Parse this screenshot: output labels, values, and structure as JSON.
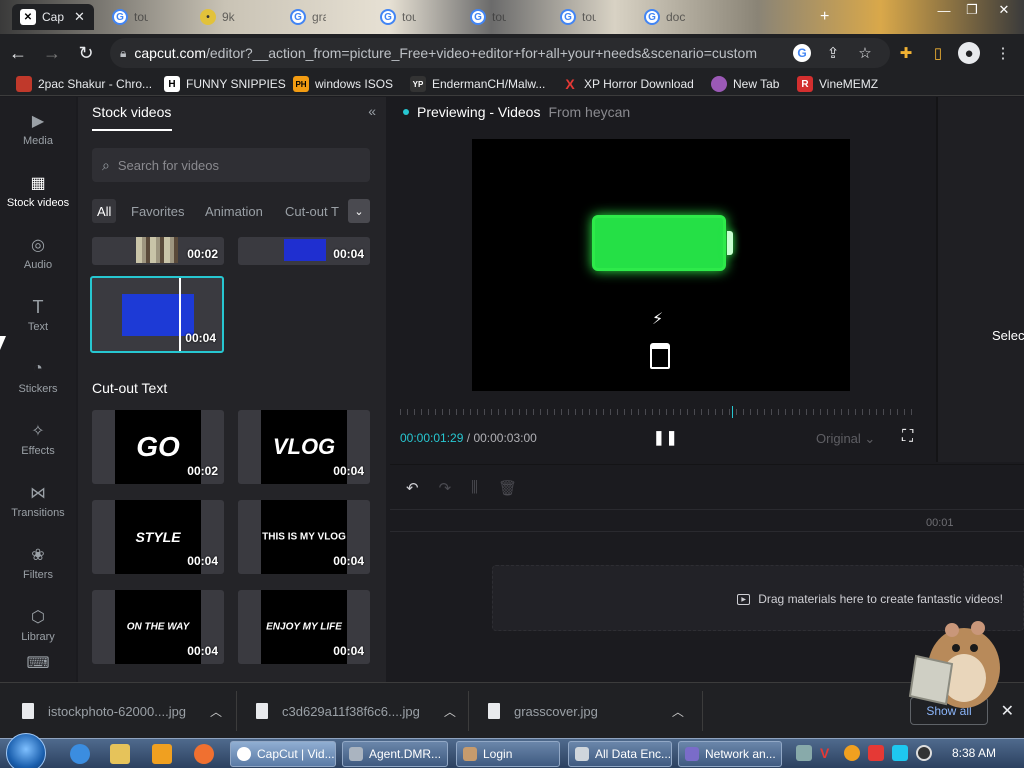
{
  "browser": {
    "tabs": [
      {
        "title": "Cap",
        "icon": "capcut-icon",
        "active": true
      },
      {
        "title": "tou",
        "icon": "google-icon"
      },
      {
        "title": "9k",
        "icon": "image-icon"
      },
      {
        "title": "gra",
        "icon": "google-icon"
      },
      {
        "title": "tou",
        "icon": "google-icon"
      },
      {
        "title": "tou",
        "icon": "google-icon"
      },
      {
        "title": "tou",
        "icon": "google-icon"
      },
      {
        "title": "doc",
        "icon": "google-icon"
      }
    ],
    "url_domain": "capcut.com",
    "url_rest": "/editor?__action_from=picture_Free+video+editor+for+all+your+needs&scenario=custom",
    "bookmarks": [
      {
        "label": "2pac Shakur - Chro...",
        "icon": "bookmark-2pac-icon",
        "color": "#c0392b"
      },
      {
        "label": "FUNNY SNIPPIES",
        "icon": "bookmark-h-icon",
        "glyph": "H",
        "color": "#ffffff"
      },
      {
        "label": "windows ISOS",
        "icon": "bookmark-ph-icon",
        "glyph": "PH",
        "color": "#f39c12"
      },
      {
        "label": "EndermanCH/Malw...",
        "icon": "bookmark-yp-icon",
        "glyph": "YP",
        "color": "#222222"
      },
      {
        "label": "XP Horror Download",
        "icon": "bookmark-x-icon",
        "glyph": "X",
        "color": "#e53935"
      },
      {
        "label": "New Tab",
        "icon": "bookmark-newtab-icon",
        "color": "#9b59b6"
      },
      {
        "label": "VineMEMZ",
        "icon": "bookmark-r-icon",
        "glyph": "R",
        "color": "#d32f2f"
      }
    ]
  },
  "capcut": {
    "left_nav": [
      {
        "label": "Media",
        "icon": "media-icon",
        "glyph": "▶"
      },
      {
        "label": "Stock videos",
        "icon": "stock-videos-icon",
        "glyph": "▦",
        "active": true
      },
      {
        "label": "Audio",
        "icon": "audio-icon",
        "glyph": "◎"
      },
      {
        "label": "Text",
        "icon": "text-icon",
        "glyph": "T"
      },
      {
        "label": "Stickers",
        "icon": "stickers-icon",
        "glyph": "◔"
      },
      {
        "label": "Effects",
        "icon": "effects-icon",
        "glyph": "✧"
      },
      {
        "label": "Transitions",
        "icon": "transitions-icon",
        "glyph": "⋈"
      },
      {
        "label": "Filters",
        "icon": "filters-icon",
        "glyph": "❀"
      },
      {
        "label": "Library",
        "icon": "library-icon",
        "glyph": "⬡"
      }
    ],
    "panel": {
      "title": "Stock videos",
      "search_placeholder": "Search for videos",
      "filters": [
        "All",
        "Favorites",
        "Animation",
        "Cut-out T"
      ],
      "top_clips": [
        {
          "duration": "00:02"
        },
        {
          "duration": "00:04"
        },
        {
          "duration": "00:04",
          "selected": true
        }
      ],
      "section_title": "Cut-out Text",
      "cutout_clips": [
        {
          "text": "GO",
          "duration": "00:02"
        },
        {
          "text": "VLOG",
          "duration": "00:04"
        },
        {
          "text": "STYLE",
          "duration": "00:04"
        },
        {
          "text": "THIS IS MY VLOG",
          "duration": "00:04"
        },
        {
          "text": "ON THE WAY",
          "duration": "00:04"
        },
        {
          "text": "ENJOY MY LIFE",
          "duration": "00:04"
        }
      ]
    },
    "preview": {
      "title": "Previewing - Videos",
      "source": "From heycan",
      "current_time": "00:00:01:29",
      "separator": "/",
      "total_time": "00:00:03:00",
      "ratio": "Original",
      "progress": 0.64
    },
    "right_pane": {
      "text": "Selec"
    },
    "timeline": {
      "time_mark": "00:01",
      "drop_text": "Drag materials here to create fantastic videos!"
    }
  },
  "downloads": [
    {
      "name": "istockphoto-62000....jpg"
    },
    {
      "name": "c3d629a11f38f6c6....jpg"
    },
    {
      "name": "grasscover.jpg"
    }
  ],
  "downloads_show_all": "Show all",
  "taskbar": {
    "tasks": [
      {
        "label": "CapCut | Vid...",
        "color": "#ffffff",
        "active": true
      },
      {
        "label": "Agent.DMR...",
        "color": "#aab4c0"
      },
      {
        "label": "Login",
        "color": "#c69b6d"
      },
      {
        "label": "All Data Enc...",
        "color": "#d0d6dc"
      },
      {
        "label": "Network an...",
        "color": "#7a6cc9"
      }
    ],
    "clock": "8:38 AM"
  }
}
